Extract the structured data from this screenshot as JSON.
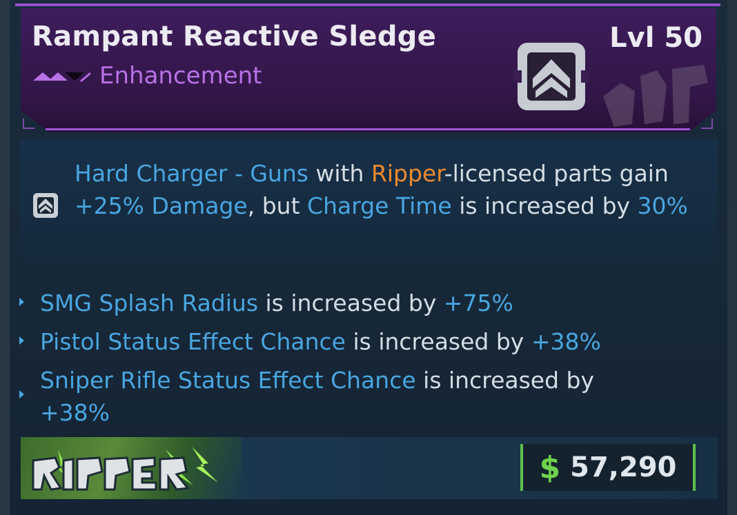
{
  "item": {
    "name": "Rampant Reactive Sledge",
    "level_label": "Lvl 50",
    "rarity": "Enhancement",
    "type_icon": "chevron-up-emblem-icon",
    "manufacturer": "Ripper"
  },
  "perk": {
    "icon": "chevron-up-emblem-icon",
    "parts": [
      {
        "text": "Hard Charger",
        "style": "blue"
      },
      {
        "text": " - ",
        "style": "blue"
      },
      {
        "text": "Guns",
        "style": "blue"
      },
      {
        "text": " with ",
        "style": "white"
      },
      {
        "text": "Ripper",
        "style": "orange"
      },
      {
        "text": "-licensed parts gain ",
        "style": "white"
      },
      {
        "text": "+25% Damage",
        "style": "blue"
      },
      {
        "text": ", but ",
        "style": "white"
      },
      {
        "text": "Charge Time",
        "style": "blue"
      },
      {
        "text": " is increased by ",
        "style": "white"
      },
      {
        "text": "30%",
        "style": "blue"
      }
    ]
  },
  "stats": [
    {
      "stat": "SMG Splash Radius",
      "mid": " is increased by ",
      "value": "+75%"
    },
    {
      "stat": "Pistol Status Effect Chance",
      "mid": " is increased by ",
      "value": "+38%"
    },
    {
      "stat": "Sniper Rifle Status Effect Chance",
      "mid": " is increased by ",
      "value": "+38%"
    }
  ],
  "price": {
    "currency_icon": "dollar-icon",
    "currency_symbol": "$",
    "value": "57,290"
  },
  "colors": {
    "rarity_purple": "#b872e6",
    "highlight_blue": "#49a6e2",
    "manufacturer_orange": "#ef8a2e",
    "price_green": "#6fd44c"
  }
}
